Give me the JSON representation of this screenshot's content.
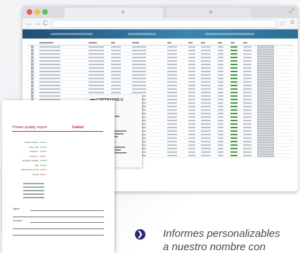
{
  "caption": {
    "line1": "Informes personalizables",
    "line2": "a nuestro nombre con"
  },
  "report": {
    "title": "Power quality report",
    "status": "Failed",
    "rows": [
      {
        "label": "Voltage variation",
        "value": "Passed",
        "status": "pass"
      },
      {
        "label": "Flicker (Plt)",
        "value": "Passed",
        "status": "pass"
      },
      {
        "label": "Unbalance",
        "value": "Passed",
        "status": "pass"
      },
      {
        "label": "Frequency",
        "value": "Failed",
        "status": "fail"
      },
      {
        "label": "Signalling voltages",
        "value": "Passed",
        "status": "pass"
      },
      {
        "label": "THD",
        "value": "Passed",
        "status": "pass"
      },
      {
        "label": "Individual harmonics",
        "value": "Passed",
        "status": "pass"
      },
      {
        "label": "Overall",
        "value": "Failed",
        "status": "fail"
      }
    ],
    "signature_labels": [
      "Signed",
      "Comment"
    ]
  },
  "doc": {
    "logo": "UNITRONICS"
  },
  "icons": {
    "back": "←",
    "forward": "→",
    "reload": "C",
    "star": "☆",
    "menu": "≡",
    "close_tab": "✕",
    "caption_bullet": "❯"
  },
  "colors": {
    "brand": "#2c2a73",
    "pass": "#2e8b2e",
    "fail": "#c62828"
  }
}
